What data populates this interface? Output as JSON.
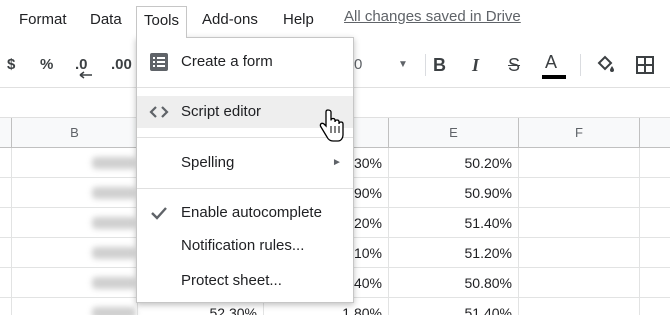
{
  "menubar": {
    "items": [
      "Format",
      "Data",
      "Tools",
      "Add-ons",
      "Help"
    ],
    "saved_status": "All changes saved in Drive"
  },
  "toolbar": {
    "currency": "$",
    "percent": "%",
    "decrease_decimal": ".0",
    "increase_decimal": ".00",
    "font_size": "0",
    "bold": "B",
    "italic": "I",
    "strikethrough": "S",
    "text_color": "A",
    "text_color_value": "#000000"
  },
  "grid": {
    "columns": [
      "B",
      "E",
      "F"
    ],
    "column_d_values": [
      "30%",
      "90%",
      "20%",
      "10%",
      "40%",
      "1.80%"
    ],
    "column_e_values": [
      "50.20%",
      "50.90%",
      "51.40%",
      "51.20%",
      "50.80%",
      "51.40%"
    ],
    "partial_c_value": "52.30%"
  },
  "tools_menu": {
    "items": [
      {
        "label": "Create a form",
        "icon": "form-icon"
      },
      {
        "label": "Script editor",
        "icon": "code-icon"
      },
      {
        "label": "Spelling",
        "icon": "submenu-arrow-icon"
      },
      {
        "label": "Enable autocomplete",
        "icon": "check-icon"
      },
      {
        "label": "Notification rules...",
        "icon": ""
      },
      {
        "label": "Protect sheet...",
        "icon": ""
      }
    ]
  }
}
